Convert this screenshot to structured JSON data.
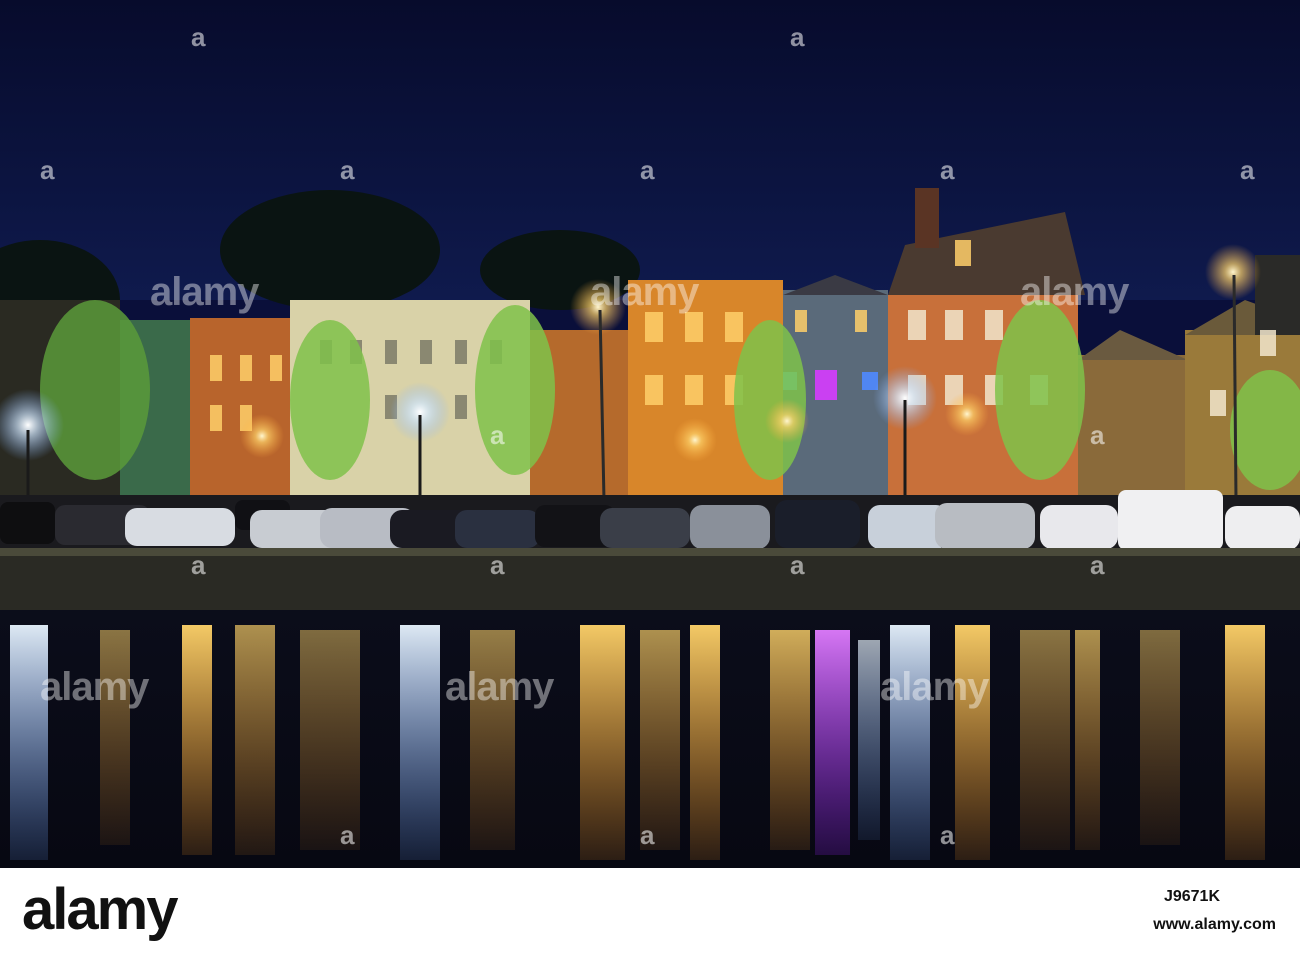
{
  "footer": {
    "logo_text": "alamy",
    "image_id": "J9671K",
    "source": "www.alamy.com"
  },
  "watermark": {
    "text": "alamy",
    "letter": "a"
  },
  "colors": {
    "sky": "#0a0f3a",
    "water": "#0b0e1e",
    "light_warm": "#ffd36a",
    "light_cool": "#cfe6ff",
    "neon_magenta": "#d63cff",
    "tree_green": "#7fc24a"
  }
}
